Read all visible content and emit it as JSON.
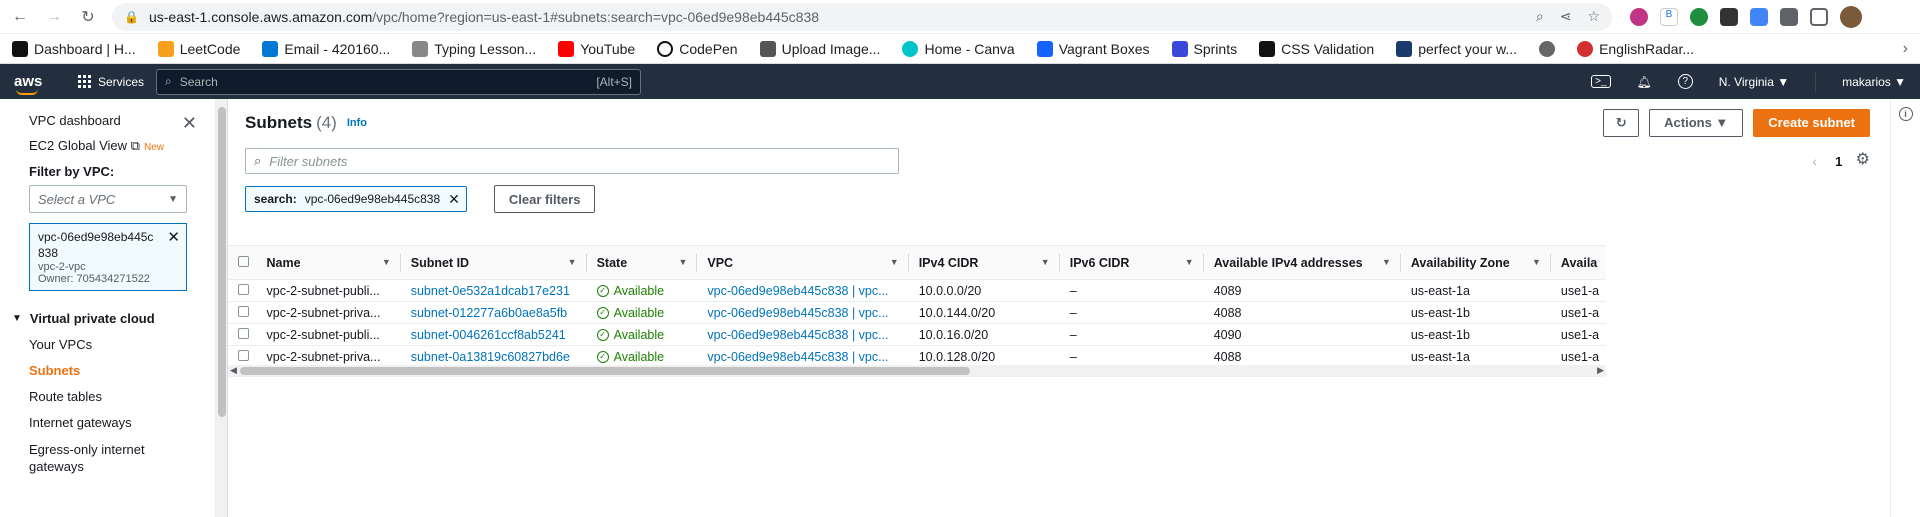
{
  "browser": {
    "url_host": "us-east-1.console.aws.amazon.com",
    "url_path": "/vpc/home?region=us-east-1#subnets:search=vpc-06ed9e98eb445c838",
    "bookmarks": [
      "Dashboard | H...",
      "LeetCode",
      "Email - 420160...",
      "Typing Lesson...",
      "YouTube",
      "CodePen",
      "Upload Image...",
      "Home - Canva",
      "Vagrant Boxes",
      "Sprints",
      "CSS Validation",
      "perfect your w...",
      "",
      "EnglishRadar..."
    ]
  },
  "aws_nav": {
    "logo": "aws",
    "services": "Services",
    "search_placeholder": "Search",
    "search_shortcut": "[Alt+S]",
    "region": "N. Virginia ▼",
    "user": "makarios ▼"
  },
  "sidebar": {
    "dashboard": "VPC dashboard",
    "global_view": "EC2 Global View",
    "new_badge": "New",
    "filter_label": "Filter by VPC:",
    "select_placeholder": "Select a VPC",
    "selected_vpc": "vpc-06ed9e98eb445c838",
    "selected_vpc_name": "vpc-2-vpc",
    "selected_vpc_owner": "Owner: 705434271522",
    "section": "Virtual private cloud",
    "items": [
      "Your VPCs",
      "Subnets",
      "Route tables",
      "Internet gateways",
      "Egress-only internet gateways"
    ]
  },
  "page": {
    "title": "Subnets",
    "count": "(4)",
    "info": "Info",
    "actions": "Actions ▼",
    "create": "Create subnet",
    "filter_placeholder": "Filter subnets",
    "chip_key": "search:",
    "chip_value": "vpc-06ed9e98eb445c838",
    "clear_filters": "Clear filters",
    "page_number": "1"
  },
  "table": {
    "columns": [
      "Name",
      "Subnet ID",
      "State",
      "VPC",
      "IPv4 CIDR",
      "IPv6 CIDR",
      "Available IPv4 addresses",
      "Availability Zone",
      "Availa"
    ],
    "rows": [
      [
        "vpc-2-subnet-publi...",
        "subnet-0e532a1dcab17e231",
        "Available",
        "vpc-06ed9e98eb445c838 | vpc...",
        "10.0.0.0/20",
        "–",
        "4089",
        "us-east-1a",
        "use1-a"
      ],
      [
        "vpc-2-subnet-priva...",
        "subnet-012277a6b0ae8a5fb",
        "Available",
        "vpc-06ed9e98eb445c838 | vpc...",
        "10.0.144.0/20",
        "–",
        "4088",
        "us-east-1b",
        "use1-a"
      ],
      [
        "vpc-2-subnet-publi...",
        "subnet-0046261ccf8ab5241",
        "Available",
        "vpc-06ed9e98eb445c838 | vpc...",
        "10.0.16.0/20",
        "–",
        "4090",
        "us-east-1b",
        "use1-a"
      ],
      [
        "vpc-2-subnet-priva...",
        "subnet-0a13819c60827bd6e",
        "Available",
        "vpc-06ed9e98eb445c838 | vpc...",
        "10.0.128.0/20",
        "–",
        "4088",
        "us-east-1a",
        "use1-a"
      ]
    ]
  },
  "colors": {
    "aws_nav": "#232f3e",
    "accent": "#ec7211",
    "link": "#0073bb",
    "available": "#1d8102"
  }
}
